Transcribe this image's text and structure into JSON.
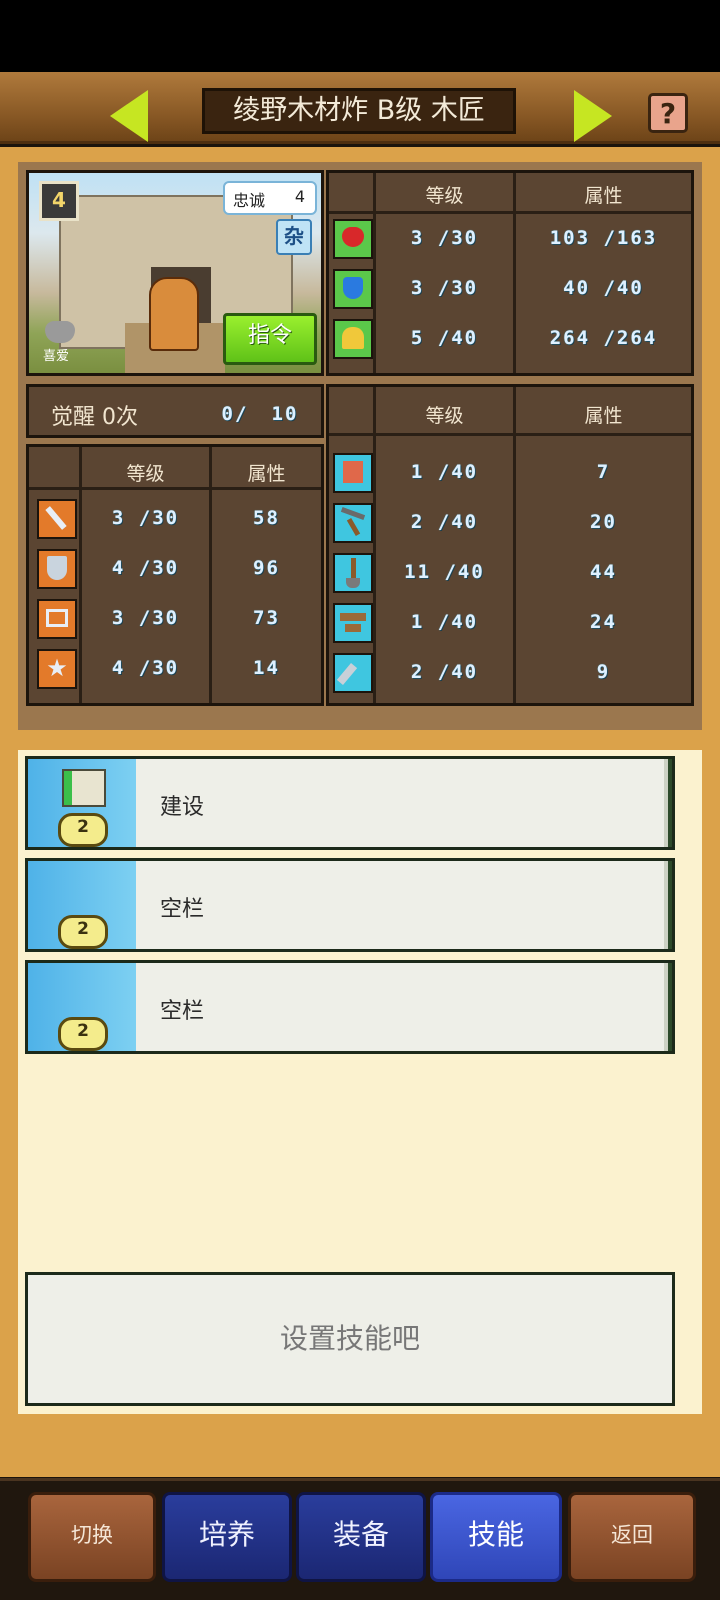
{
  "header": {
    "title": "绫野木材炸 B级 木匠",
    "help_label": "?"
  },
  "portrait": {
    "level_badge": "4",
    "loyalty_label": "忠诚",
    "loyalty_value": "4",
    "type_badge": "杂",
    "fav_label": "喜爱",
    "command_label": "指令"
  },
  "vitals": {
    "headers": [
      "等级",
      "属性"
    ],
    "rows": [
      {
        "icon": "heart-icon",
        "level": "3 /30",
        "value": "103 /163"
      },
      {
        "icon": "potion-icon",
        "level": "3 /30",
        "value": "40 /40"
      },
      {
        "icon": "stamina-icon",
        "level": "5 /40",
        "value": "264 /264"
      }
    ]
  },
  "awaken": {
    "label": "觉醒 0次",
    "progress": "0/",
    "max": "10"
  },
  "combat": {
    "headers": [
      "等级",
      "属性"
    ],
    "rows": [
      {
        "icon": "sword-icon",
        "level": "3 /30",
        "value": "58"
      },
      {
        "icon": "shield-icon",
        "level": "4 /30",
        "value": "96"
      },
      {
        "icon": "agility-icon",
        "level": "3 /30",
        "value": "73"
      },
      {
        "icon": "luck-star-icon",
        "level": "4 /30",
        "value": "14"
      }
    ]
  },
  "crafting": {
    "headers": [
      "等级",
      "属性"
    ],
    "rows": [
      {
        "icon": "brick-icon",
        "level": "1 /40",
        "value": "7"
      },
      {
        "icon": "pickaxe-icon",
        "level": "2 /40",
        "value": "20"
      },
      {
        "icon": "shovel-icon",
        "level": "11 /40",
        "value": "44"
      },
      {
        "icon": "anvil-icon",
        "level": "1 /40",
        "value": "24"
      },
      {
        "icon": "tool-icon",
        "level": "2 /40",
        "value": "9"
      }
    ]
  },
  "skills": [
    {
      "label": "建设",
      "coin": "2",
      "has_icon": true
    },
    {
      "label": "空栏",
      "coin": "2",
      "has_icon": false
    },
    {
      "label": "空栏",
      "coin": "2",
      "has_icon": false
    }
  ],
  "hint": "设置技能吧",
  "nav": {
    "switch": "切换",
    "train": "培养",
    "equip": "装备",
    "skill": "技能",
    "back": "返回"
  },
  "colors": {
    "accent_green": "#c6e622",
    "nav_active": "#3b56cf",
    "panel_bg": "#5b4532",
    "skill_blue": "#4fb2e8"
  }
}
